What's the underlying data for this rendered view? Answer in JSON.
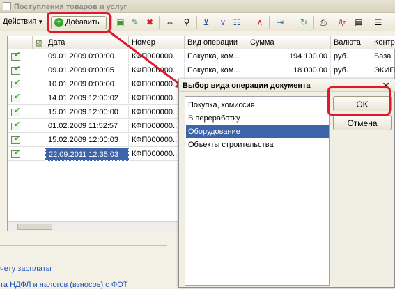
{
  "window": {
    "title": "Поступления товаров и услуг"
  },
  "toolbar": {
    "actions_label": "Действия",
    "add_label": "Добавить"
  },
  "table": {
    "columns": [
      "Дата",
      "Номер",
      "Вид операции",
      "Сумма",
      "Валюта",
      "Контр"
    ],
    "rows": [
      {
        "date": "09.01.2009 0:00:00",
        "number": "КФП000000...",
        "op": "Покупка, ком...",
        "sum": "194 100,00",
        "currency": "руб.",
        "contractor": "База"
      },
      {
        "date": "09.01.2009 0:00:05",
        "number": "КФП000000...",
        "op": "Покупка, ком...",
        "sum": "18 000,00",
        "currency": "руб.",
        "contractor": "ЭКИП"
      },
      {
        "date": "10.01.2009 0:00:00",
        "number": "КФП000000...",
        "op": "",
        "sum": "",
        "currency": "",
        "contractor": ""
      },
      {
        "date": "14.01.2009 12:00:02",
        "number": "КФП000000...",
        "op": "",
        "sum": "",
        "currency": "",
        "contractor": ""
      },
      {
        "date": "15.01.2009 12:00:00",
        "number": "КФП000000...",
        "op": "",
        "sum": "",
        "currency": "",
        "contractor": ""
      },
      {
        "date": "01.02.2009 11:52:57",
        "number": "КФП000000...",
        "op": "",
        "sum": "",
        "currency": "",
        "contractor": ""
      },
      {
        "date": "15.02.2009 12:00:03",
        "number": "КФП000000...",
        "op": "",
        "sum": "",
        "currency": "",
        "contractor": ""
      },
      {
        "date": "22.09.2011 12:35:03",
        "number": "КФП000000...",
        "op": "",
        "sum": "",
        "currency": "",
        "contractor": ""
      }
    ]
  },
  "links": [
    "чету зарплаты",
    "та НДФЛ и налогов (взносов) с ФОТ"
  ],
  "dialog": {
    "title": "Выбор вида операции документа",
    "close": "✕",
    "items": [
      "Покупка, комиссия",
      "В переработку",
      "Оборудование",
      "Объекты строительства"
    ],
    "selected_index": 2,
    "ok_label": "OK",
    "cancel_label": "Отмена"
  },
  "colors": {
    "highlight": "#e0182c",
    "selection": "#3d63a8",
    "link": "#1f52b8"
  }
}
